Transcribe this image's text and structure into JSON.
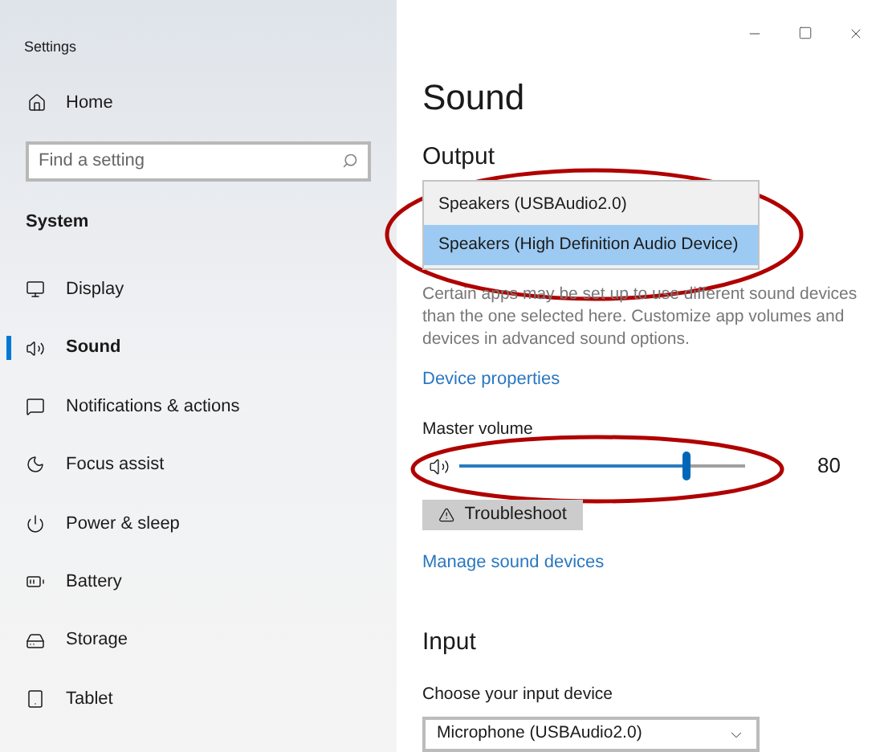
{
  "window": {
    "title": "Settings"
  },
  "sidebar": {
    "home": "Home",
    "search": {
      "placeholder": "Find a setting"
    },
    "section": "System",
    "items": [
      {
        "label": "Display",
        "selected": false
      },
      {
        "label": "Sound",
        "selected": true
      },
      {
        "label": "Notifications & actions",
        "selected": false
      },
      {
        "label": "Focus assist",
        "selected": false
      },
      {
        "label": "Power & sleep",
        "selected": false
      },
      {
        "label": "Battery",
        "selected": false
      },
      {
        "label": "Storage",
        "selected": false
      },
      {
        "label": "Tablet",
        "selected": false
      }
    ]
  },
  "page": {
    "title": "Sound",
    "output": {
      "heading": "Output",
      "devices": [
        {
          "label": "Speakers (USBAudio2.0)",
          "selected": false
        },
        {
          "label": "Speakers (High Definition Audio Device)",
          "selected": true
        }
      ],
      "description": "Certain apps may be set up to use different sound devices than the one selected here. Customize app volumes and devices in advanced sound options.",
      "link": "Device properties",
      "volume": {
        "label": "Master volume",
        "level": 0.8,
        "reading": "80"
      },
      "troubleshoot": "Troubleshoot",
      "manage_link": "Manage sound devices"
    },
    "input": {
      "heading": "Input",
      "label": "Choose your input device",
      "value": "Microphone (USBAudio2.0)"
    }
  }
}
